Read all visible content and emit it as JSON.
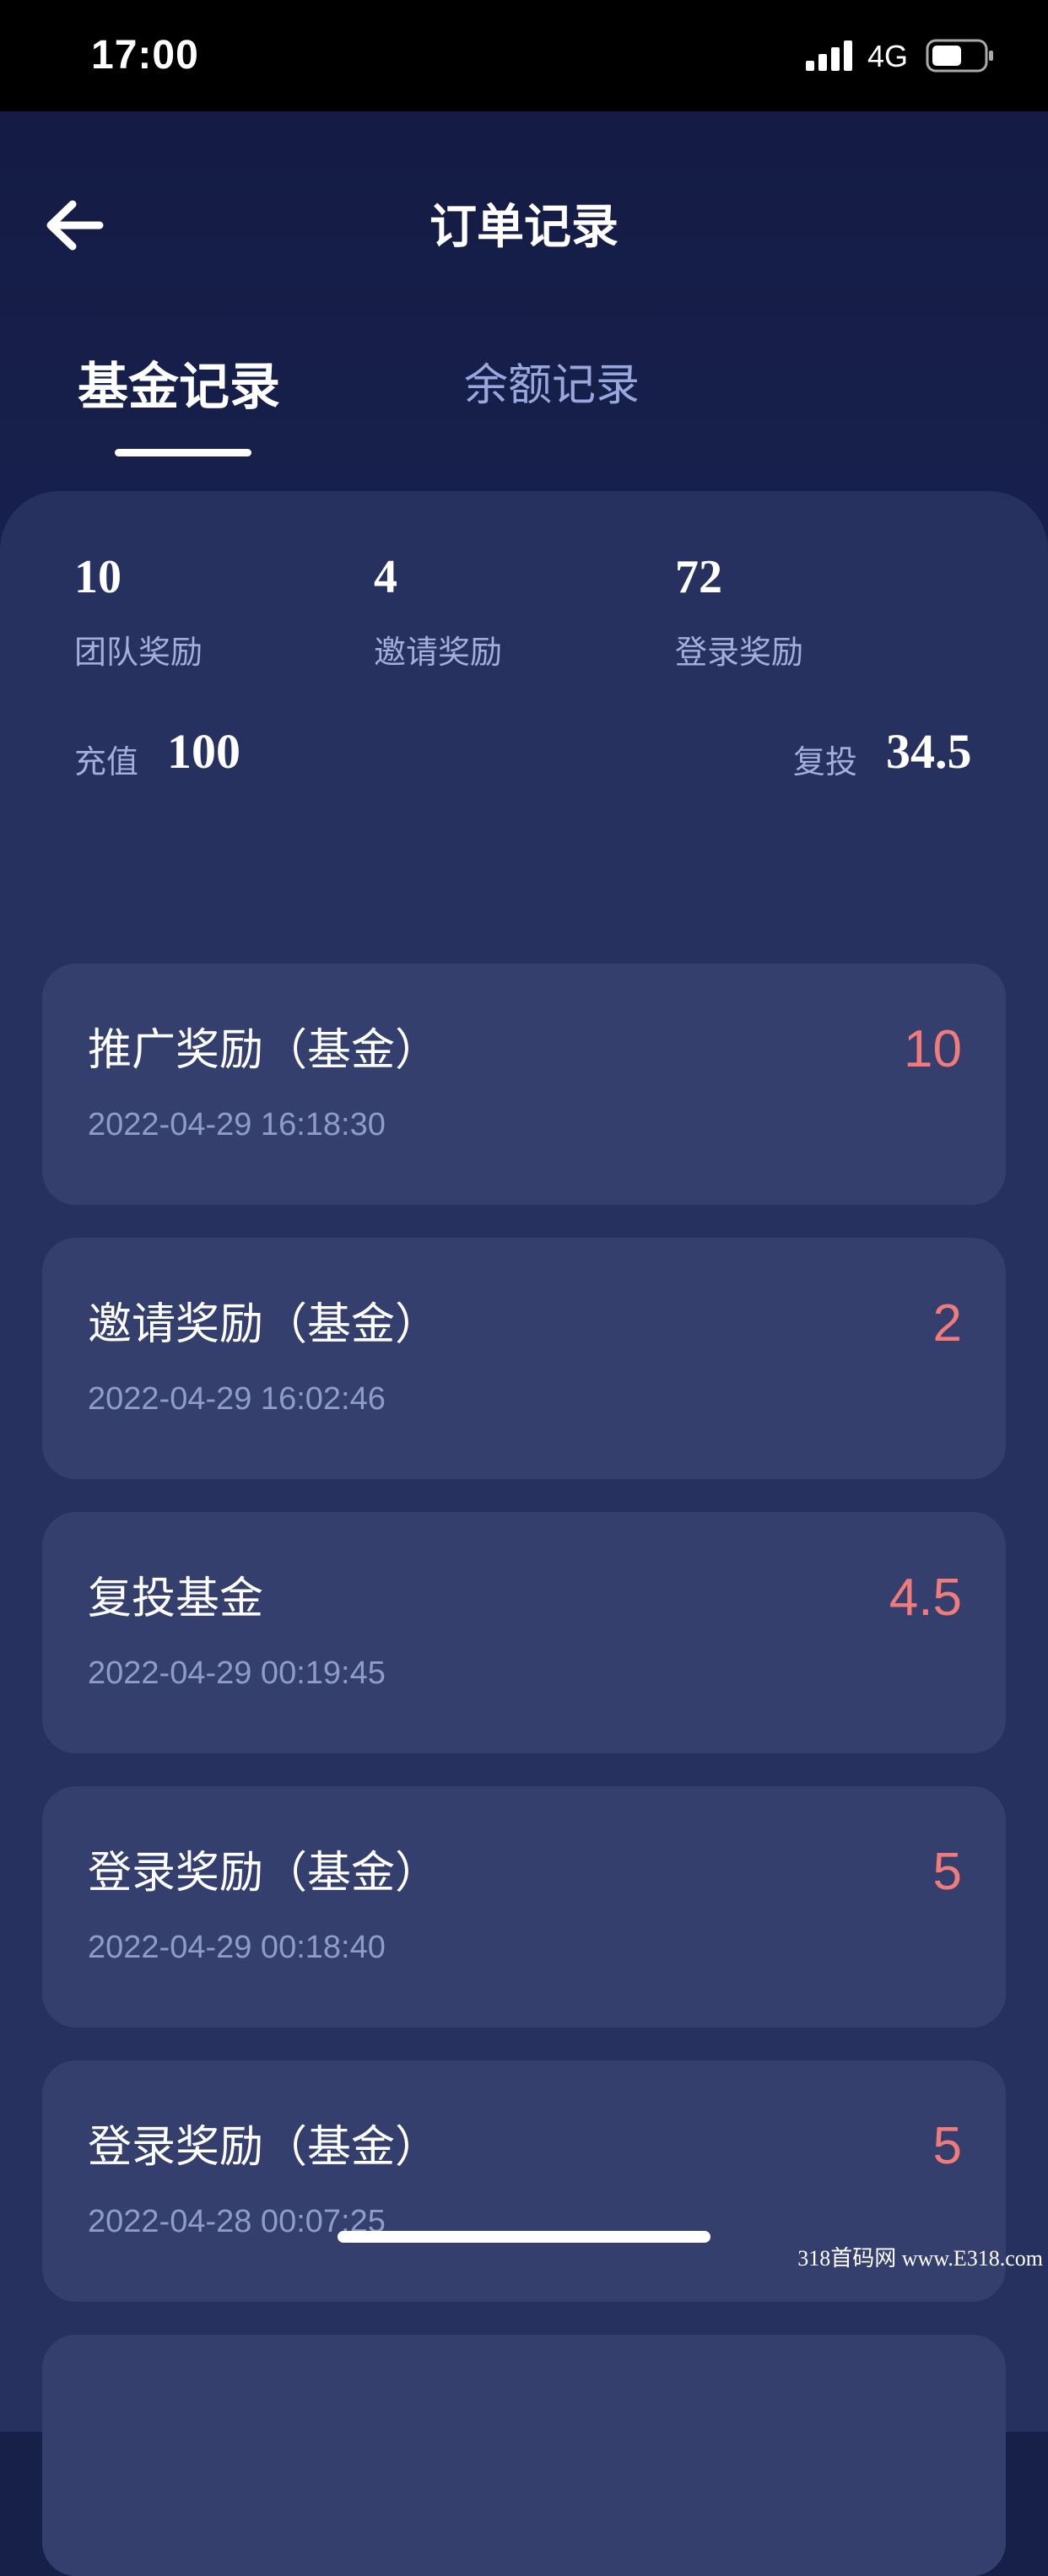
{
  "status_bar": {
    "time": "17:00",
    "network": "4G",
    "icons": [
      "signal-icon",
      "battery-icon"
    ]
  },
  "header": {
    "title": "订单记录",
    "back_icon": "arrow-left-icon"
  },
  "tabs": [
    {
      "label": "基金记录",
      "active": true
    },
    {
      "label": "余额记录",
      "active": false
    }
  ],
  "summary": {
    "stats": [
      {
        "value": "10",
        "label": "团队奖励"
      },
      {
        "value": "4",
        "label": "邀请奖励"
      },
      {
        "value": "72",
        "label": "登录奖励"
      }
    ],
    "recharge": {
      "label": "充值",
      "value": "100"
    },
    "reinvest": {
      "label": "复投",
      "value": "34.5"
    }
  },
  "records": [
    {
      "title": "推广奖励（基金）",
      "time": "2022-04-29 16:18:30",
      "amount": "10"
    },
    {
      "title": "邀请奖励（基金）",
      "time": "2022-04-29 16:02:46",
      "amount": "2"
    },
    {
      "title": "复投基金",
      "time": "2022-04-29 00:19:45",
      "amount": "4.5"
    },
    {
      "title": "登录奖励（基金）",
      "time": "2022-04-29 00:18:40",
      "amount": "5"
    },
    {
      "title": "登录奖励（基金）",
      "time": "2022-04-28 00:07:25",
      "amount": "5"
    }
  ],
  "colors": {
    "background": "#172049",
    "panel": "#26315f",
    "card": "#343f6e",
    "amount": "#f07b7b",
    "muted_text": "#a3aedb"
  },
  "watermark": "318首码网 www.E318.com"
}
